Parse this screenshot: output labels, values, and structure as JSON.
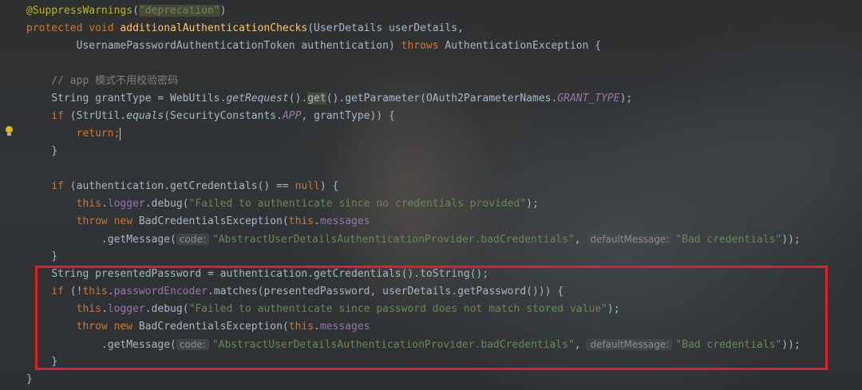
{
  "code": {
    "annotation": "@SuppressWarnings",
    "annotation_arg": "\"deprecation\"",
    "kw_protected": "protected",
    "kw_void": "void",
    "method_name": "additionalAuthenticationChecks",
    "sig1_params": "(UserDetails userDetails,",
    "sig2_params": "UsernamePasswordAuthenticationToken authentication)",
    "kw_throws": "throws",
    "sig2_exception": "AuthenticationException {",
    "comment": "// app 模式不用校验密码",
    "l5_a": "String grantType = WebUtils.",
    "l5_getRequest": "getRequest",
    "l5_b": "().",
    "l5_get": "get",
    "l5_c": "().getParameter(OAuth2ParameterNames.",
    "l5_grant": "GRANT_TYPE",
    "l5_d": ");",
    "kw_if": "if",
    "l6_a": "(StrUtil.",
    "l6_equals": "equals",
    "l6_b": "(SecurityConstants.",
    "l6_app": "APP",
    "l6_c": ", grantType)) {",
    "kw_return": "return",
    "semicolon": ";",
    "close_brace": "}",
    "l10_a": "(authentication.getCredentials() ==",
    "kw_null": "null",
    "l10_b": ") {",
    "kw_this": "this",
    "dot": ".",
    "logger": "logger",
    "debug_open": ".debug(",
    "msg_no_creds": "\"Failed to authenticate since no credentials provided\"",
    "close_paren_semi": ");",
    "kw_throw": "throw",
    "kw_new": "new",
    "bad_creds_exc": "BadCredentialsException(",
    "messages": "messages",
    "get_message": ".getMessage(",
    "hint_code": "code:",
    "str_code": "\"AbstractUserDetailsAuthenticationProvider.badCredentials\"",
    "comma": ",",
    "hint_default": "defaultMessage:",
    "str_default": "\"Bad credentials\"",
    "close_double": "));",
    "l15": "String presentedPassword = authentication.getCredentials().toString();",
    "l16_a": "(!",
    "password_encoder": "passwordEncoder",
    "l16_b": ".matches(presentedPassword, userDetails.getPassword())) {",
    "msg_pwd": "\"Failed to authenticate since password does not match stored value\""
  },
  "icons": {
    "gutter": "lightbulb-icon"
  },
  "colors": {
    "highlight_box": "#e31e2a",
    "keyword": "#cc7832",
    "string": "#6a8759",
    "field": "#9876aa",
    "method": "#ffc66d",
    "annotation": "#bbb529"
  }
}
